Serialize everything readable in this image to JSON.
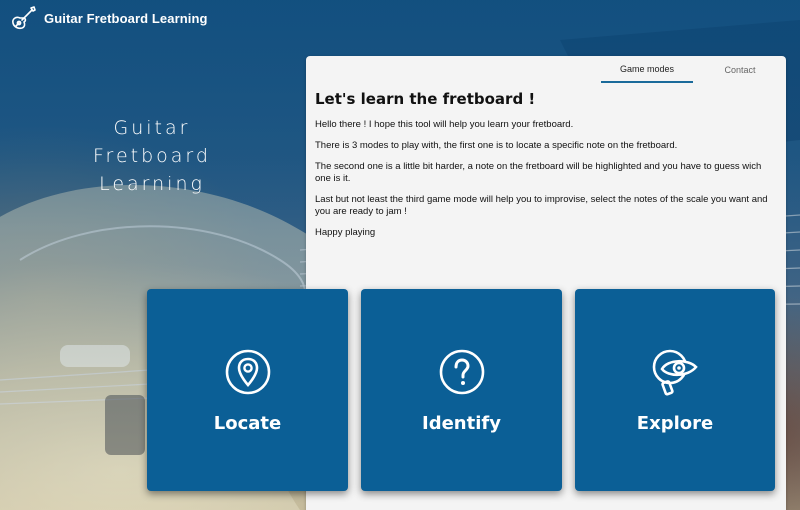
{
  "header": {
    "title": "Guitar Fretboard Learning",
    "logo_icon": "guitar-icon"
  },
  "hero": {
    "line1": "Guitar",
    "line2": "Fretboard",
    "line3": "Learning"
  },
  "tabs": [
    {
      "label": "Game modes",
      "active": true
    },
    {
      "label": "Contact",
      "active": false
    }
  ],
  "content": {
    "heading": "Let's learn the fretboard !",
    "paragraphs": [
      "Hello there ! I hope this tool will help you learn your fretboard.",
      "There is 3 modes to play with, the first one is to locate a specific note on the fretboard.",
      "The second one is a little bit harder, a note on the fretboard will be highlighted and you have to guess wich one is it.",
      "Last but not least the third game mode will help you to improvise, select the notes of the scale you want and you are ready to jam !",
      "Happy playing"
    ]
  },
  "modes": [
    {
      "label": "Locate",
      "icon": "map-pin-icon"
    },
    {
      "label": "Identify",
      "icon": "question-circle-icon"
    },
    {
      "label": "Explore",
      "icon": "eye-magnifier-icon"
    }
  ],
  "colors": {
    "primary": "#0b5f96",
    "card_background": "#f4f4f4",
    "tab_indicator": "#1a6a9a"
  }
}
